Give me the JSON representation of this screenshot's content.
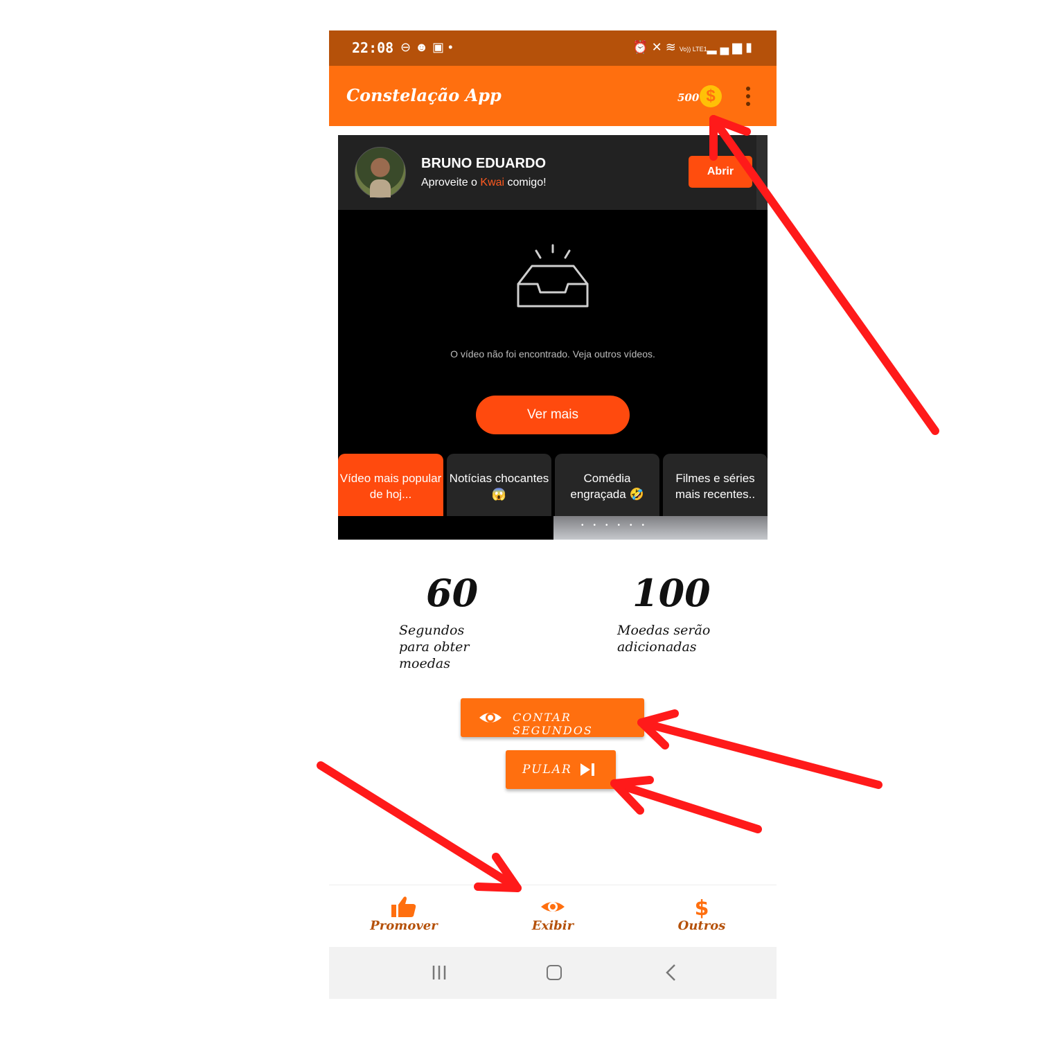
{
  "status_bar": {
    "time": "22:08",
    "left_icons": [
      "do-not-disturb-icon",
      "discord-icon",
      "gallery-icon",
      "dot-icon"
    ],
    "right_icons": [
      "alarm-icon",
      "mute-icon",
      "wifi-icon",
      "volte-icon",
      "signal-icon",
      "signal-icon",
      "battery-icon"
    ],
    "volte_label": "Vo)) LTE1"
  },
  "app_bar": {
    "title": "Constelação App",
    "coins": "500",
    "coin_symbol": "$"
  },
  "profile": {
    "name": "BRUNO EDUARDO",
    "subtitle_prefix": "Aproveite o ",
    "subtitle_brand": "Kwai",
    "subtitle_suffix": " comigo!",
    "open_button": "Abrir"
  },
  "video": {
    "empty_message": "O vídeo não foi encontrado. Veja outros vídeos.",
    "see_more_button": "Ver mais"
  },
  "tabs": [
    {
      "label": "Vídeo mais popular de hoj...",
      "active": true
    },
    {
      "label": "Notícias chocantes 😱",
      "active": false
    },
    {
      "label": "Comédia engraçada 🤣",
      "active": false
    },
    {
      "label": "Filmes e séries mais recentes..",
      "active": false
    }
  ],
  "stats": {
    "seconds_value": "60",
    "seconds_label": "Segundos para obter moedas",
    "coins_value": "100",
    "coins_label": "Moedas serão adicionadas"
  },
  "actions": {
    "count_seconds": "CONTAR SEGUNDOS",
    "skip": "PULAR"
  },
  "bottom_nav": [
    {
      "label": "Promover",
      "icon": "thumbs-up-icon"
    },
    {
      "label": "Exibir",
      "icon": "eye-icon"
    },
    {
      "label": "Outros",
      "icon": "dollar-icon"
    }
  ],
  "colors": {
    "primary": "#ff6f0f",
    "status_bar": "#b5510a",
    "accent": "#ff4a0e",
    "annotation_arrow": "#ff1a1a"
  }
}
